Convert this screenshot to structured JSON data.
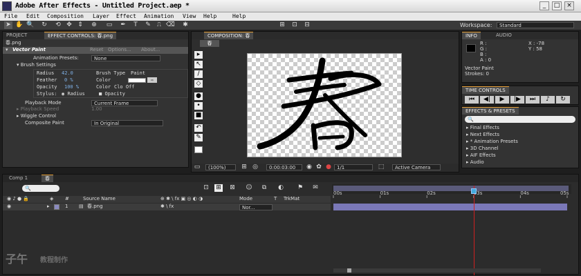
{
  "window": {
    "title": "Adobe After Effects - Untitled Project.aep *",
    "min": "_",
    "max": "□",
    "close": "×"
  },
  "menu": [
    "File",
    "Edit",
    "Composition",
    "Layer",
    "Effect",
    "Animation",
    "View",
    "Help"
  ],
  "workspace": {
    "label": "Workspace:",
    "value": "Standard"
  },
  "project_tab": "PROJECT",
  "effect_controls": {
    "tab": "EFFECT CONTROLS: 春.png",
    "layer": "春.png",
    "effect_name": "Vector Paint",
    "reset": "Reset",
    "options": "Options...",
    "about": "About...",
    "animation_presets_label": "Animation Presets:",
    "animation_presets_value": "None",
    "brush_settings": "Brush Settings",
    "radius_label": "Radius",
    "radius_value": "42.0",
    "brush_type_label": "Brush Type",
    "brush_type_value": "Paint",
    "feather_label": "Feather",
    "feather_value": "0 %",
    "color_label": "Color",
    "opacity_label": "Opacity",
    "opacity_value": "100 %",
    "color2_label": "Color",
    "color2_value": "Clo Off",
    "stylus_label": "Stylus:",
    "stylus_radius": "Radius",
    "stylus_opacity": "Opacity",
    "playback_mode_label": "Playback Mode",
    "playback_mode_value": "Current Frame",
    "playback_speed_label": "Playback Speed",
    "playback_speed_value": "1.00",
    "wiggle_control": "Wiggle Control",
    "composite_paint_label": "Composite Paint",
    "composite_paint_value": "In Original"
  },
  "composition": {
    "tab": "COMPOSITION: 春",
    "subtab": "春",
    "zoom": "(100%)",
    "timecode": "0:00:03:00",
    "resolution": "1/1",
    "camera": "Active Camera",
    "glyph": "春"
  },
  "info": {
    "tab": "INFO",
    "audio_tab": "AUDIO",
    "r": "R :",
    "g": "G :",
    "b": "B :",
    "a": "A : 0",
    "x": "X : -78",
    "y": "Y : 58",
    "effect": "Vector Paint",
    "strokes": "Strokes: 0"
  },
  "time_controls": {
    "tab": "TIME CONTROLS"
  },
  "effects_presets": {
    "tab": "EFFECTS & PRESETS",
    "search_placeholder": "",
    "items": [
      "Final Effects",
      "Next Effects",
      "* Animation Presets",
      "3D Channel",
      "AIF Effects",
      "Audio"
    ]
  },
  "timeline": {
    "comp_tab": "Comp 1",
    "active_tab": "春",
    "headers": {
      "source": "Source Name",
      "mode": "Mode",
      "t": "T",
      "trkmat": "TrkMat"
    },
    "layer_index": "1",
    "layer_name": "春.png",
    "layer_mode": "Nor...",
    "ruler": [
      "00s",
      "01s",
      "02s",
      "03s",
      "04s",
      "05s"
    ],
    "current_time_seconds": 3
  },
  "watermark": {
    "logo": "子午",
    "text": "教程制作"
  },
  "colors": {
    "accent": "#e8a23a",
    "playhead": "#d02020",
    "layer_bar": "#7a78b8"
  }
}
